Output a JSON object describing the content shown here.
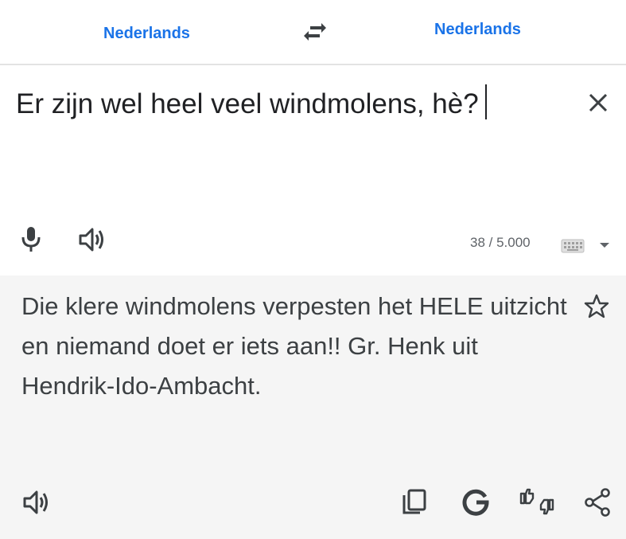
{
  "languages": {
    "source": "Nederlands",
    "target": "Nederlands"
  },
  "source": {
    "text": "Er zijn wel heel veel windmolens, hè?",
    "char_count": "38 / 5.000"
  },
  "target": {
    "text": "Die klere windmolens verpesten het HELE uitzicht en niemand doet er iets aan!! Gr. Henk uit Hendrik-Ido-Ambacht."
  },
  "icons": {
    "swap": "swap-arrows-icon",
    "clear": "close-icon",
    "mic": "microphone-icon",
    "speaker": "speaker-icon",
    "keyboard": "keyboard-icon",
    "dropdown": "caret-down-icon",
    "star": "star-outline-icon",
    "copy": "copy-icon",
    "google": "google-g-icon",
    "feedback": "thumbs-feedback-icon",
    "share": "share-icon"
  },
  "colors": {
    "accent": "#1a73e8",
    "text": "#202124",
    "secondary": "#5f6368",
    "translation_bg": "#f5f5f5"
  }
}
